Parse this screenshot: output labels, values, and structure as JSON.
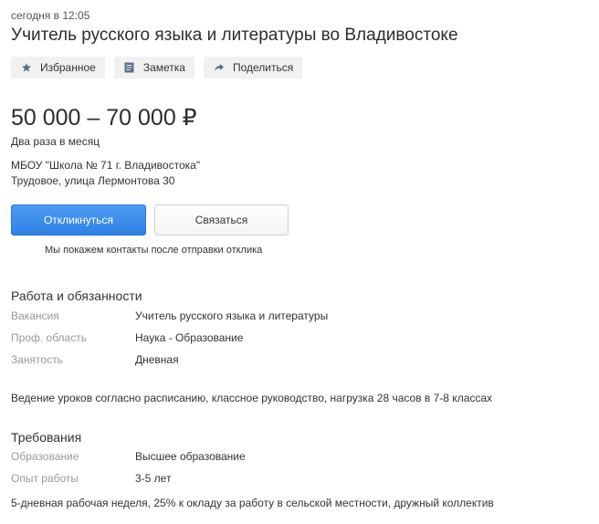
{
  "header": {
    "timestamp": "сегодня в 12:05",
    "title": "Учитель русского языка и литературы во Владивостоке"
  },
  "actions": {
    "favorite": {
      "label": "Избранное",
      "icon": "star-icon"
    },
    "note": {
      "label": "Заметка",
      "icon": "note-icon"
    },
    "share": {
      "label": "Поделиться",
      "icon": "share-arrow-icon"
    }
  },
  "salary": {
    "range": "50 000 – 70 000 ₽",
    "period": "Два раза в месяц"
  },
  "employer": {
    "name": "МБОУ \"Школа № 71 г. Владивостока\"",
    "address": "Трудовое, улица Лермонтова 30"
  },
  "buttons": {
    "respond": "Откликнуться",
    "contact": "Связаться",
    "note": "Мы покажем контакты после отправки отклика"
  },
  "duties": {
    "title": "Работа и обязанности",
    "fields": [
      {
        "label": "Вакансия",
        "value": "Учитель русского языка и литературы"
      },
      {
        "label": "Проф. область",
        "value": "Наука - Образование"
      },
      {
        "label": "Занятость",
        "value": "Дневная"
      }
    ],
    "description": "Ведение уроков согласно расписанию, классное руководство, нагрузка 28 часов в 7-8 классах"
  },
  "requirements": {
    "title": "Требования",
    "fields": [
      {
        "label": "Образование",
        "value": "Высшее образование"
      },
      {
        "label": "Опыт работы",
        "value": "3-5 лет"
      }
    ],
    "description": "5-дневная рабочая неделя, 25% к окладу за работу в сельской местности, дружный коллектив"
  },
  "colors": {
    "primary_button": "#2f82e6",
    "label_gray": "#999999",
    "action_bg": "#f1f1f1",
    "icon_gray": "#5f6f86"
  }
}
